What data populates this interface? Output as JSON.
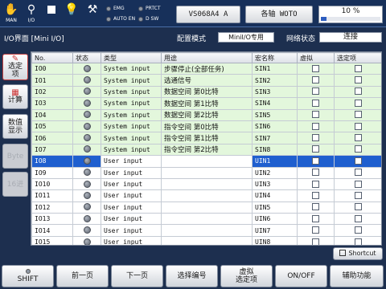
{
  "topbar": {
    "icons": [
      {
        "name": "hand-icon",
        "glyph": "✋",
        "caption": "MAN"
      },
      {
        "name": "io-icon",
        "glyph": "⚲",
        "caption": "I/O"
      },
      {
        "name": "stop-icon",
        "glyph": "",
        "caption": ""
      },
      {
        "name": "lamp-icon",
        "glyph": "💡",
        "caption": ""
      },
      {
        "name": "wrench-icon",
        "glyph": "⚒",
        "caption": ""
      }
    ],
    "leds": {
      "emg": "EMG",
      "auto_en": "AUTO EN",
      "prtct": "PRTCT",
      "dsw": "D SW"
    },
    "model": "VS068A4 A",
    "axes": "各轴 WOTO",
    "speed_text": "10 %",
    "speed_percent": 10
  },
  "info": {
    "screen_name": "I/O界面 [Mini I/O]",
    "config_label": "配置模式",
    "config_value": "MiniI/O专用",
    "network_label": "网络状态",
    "network_value": "连接"
  },
  "side": {
    "select_line1": "选定",
    "select_line2": "项",
    "calc": "计算",
    "display_line1": "数值",
    "display_line2": "显示",
    "byte": "Byte",
    "hex": "16进"
  },
  "table": {
    "headers": [
      "No.",
      "状态",
      "类型",
      "用途",
      "宏名称",
      "虚拟",
      "选定项"
    ],
    "rows": [
      {
        "no": "IO0",
        "type": "System input",
        "purpose": "步骤停止(全部任务)",
        "macro": "SIN1",
        "kind": "sys"
      },
      {
        "no": "IO1",
        "type": "System input",
        "purpose": "选通信号",
        "macro": "SIN2",
        "kind": "sys"
      },
      {
        "no": "IO2",
        "type": "System input",
        "purpose": "数据空间 第0比特",
        "macro": "SIN3",
        "kind": "sys"
      },
      {
        "no": "IO3",
        "type": "System input",
        "purpose": "数据空间 第1比特",
        "macro": "SIN4",
        "kind": "sys"
      },
      {
        "no": "IO4",
        "type": "System input",
        "purpose": "数据空间 第2比特",
        "macro": "SIN5",
        "kind": "sys"
      },
      {
        "no": "IO5",
        "type": "System input",
        "purpose": "指令空间 第0比特",
        "macro": "SIN6",
        "kind": "sys"
      },
      {
        "no": "IO6",
        "type": "System input",
        "purpose": "指令空间 第1比特",
        "macro": "SIN7",
        "kind": "sys"
      },
      {
        "no": "IO7",
        "type": "System input",
        "purpose": "指令空间 第2比特",
        "macro": "SIN8",
        "kind": "sys"
      },
      {
        "no": "IO8",
        "type": "User input",
        "purpose": "",
        "macro": "UIN1",
        "kind": "sel"
      },
      {
        "no": "IO9",
        "type": "User input",
        "purpose": "",
        "macro": "UIN2",
        "kind": "usr"
      },
      {
        "no": "IO10",
        "type": "User input",
        "purpose": "",
        "macro": "UIN3",
        "kind": "usr"
      },
      {
        "no": "IO11",
        "type": "User input",
        "purpose": "",
        "macro": "UIN4",
        "kind": "usr"
      },
      {
        "no": "IO12",
        "type": "User input",
        "purpose": "",
        "macro": "UIN5",
        "kind": "usr"
      },
      {
        "no": "IO13",
        "type": "User input",
        "purpose": "",
        "macro": "UIN6",
        "kind": "usr"
      },
      {
        "no": "IO14",
        "type": "User input",
        "purpose": "",
        "macro": "UIN7",
        "kind": "usr"
      },
      {
        "no": "IO15",
        "type": "User input",
        "purpose": "",
        "macro": "UIN8",
        "kind": "usr"
      }
    ]
  },
  "shortcut": "Shortcut",
  "bottom": {
    "shift": "SHIFT",
    "prev": "前一页",
    "next": "下一页",
    "select_number": "选择编号",
    "virtual_line1": "虚拟",
    "virtual_line2": "选定项",
    "onoff": "ON/OFF",
    "aux": "辅助功能"
  },
  "colors": {
    "background": "#1d2f4f",
    "system_row": "#e3f7dc",
    "selected_row": "#1f5fcf",
    "speed_fill": "#2e5ec0"
  }
}
